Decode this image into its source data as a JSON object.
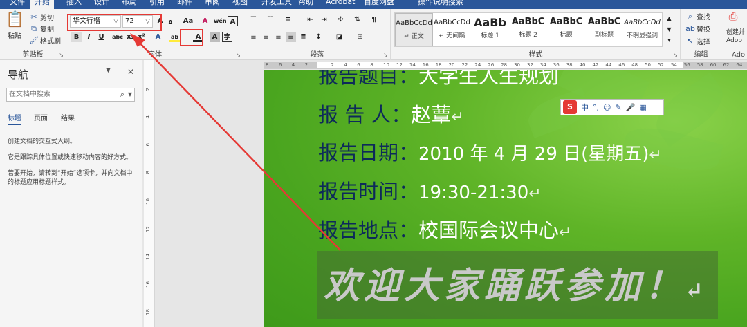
{
  "tabs": [
    "文件",
    "开始",
    "插入",
    "设计",
    "布局",
    "引用",
    "邮件",
    "审阅",
    "视图",
    "开发工具",
    "帮助",
    "Acrobat",
    "百度网盘",
    "操作说明搜索"
  ],
  "clipboard": {
    "paste": "粘贴",
    "cut": "剪切",
    "copy": "复制",
    "format_painter": "格式刷",
    "label": "剪贴板"
  },
  "font": {
    "family": "华文行楷",
    "size": "72",
    "grow": "A",
    "shrink": "A",
    "case": "Aa",
    "clear": "A",
    "label": "字体",
    "bold": "B",
    "italic": "I",
    "underline": "U",
    "strike": "abc",
    "subscript": "x₂",
    "superscript": "x²",
    "effects": "A",
    "highlight": "ab",
    "color": "A",
    "shading": "A",
    "border": "A"
  },
  "paragraph": {
    "label": "段落"
  },
  "styles": {
    "label": "样式",
    "items": [
      {
        "preview": "AaBbCcDd",
        "name": "↵ 正文"
      },
      {
        "preview": "AaBbCcDd",
        "name": "↵ 无间隔"
      },
      {
        "preview": "AaBb",
        "name": "标题 1"
      },
      {
        "preview": "AaBbC",
        "name": "标题 2"
      },
      {
        "preview": "AaBbC",
        "name": "标题"
      },
      {
        "preview": "AaBbC",
        "name": "副标题"
      },
      {
        "preview": "AaBbCcDd",
        "name": "不明显强调"
      }
    ]
  },
  "editing": {
    "find": "查找",
    "replace": "替换",
    "select": "选择",
    "label": "编辑"
  },
  "adobe": {
    "create": "创建并",
    "adobe": "Adob",
    "label": "Ado"
  },
  "nav": {
    "title": "导航",
    "search_placeholder": "在文档中搜索",
    "tabs": [
      "标题",
      "页面",
      "结果"
    ],
    "text1": "创建文档的交互式大纲。",
    "text2": "它是跟踪具体位置或快速移动内容的好方式。",
    "text3": "若要开始，请转到“开始”选项卡，并向文档中的标题应用标题样式。"
  },
  "doc": {
    "line0_label": "报告题目：",
    "line0_value": "大学生人生规划",
    "line1_label": "报 告 人：",
    "line1_value": "赵蕈",
    "line2_label": "报告日期：",
    "line2_value": "2010 年 4 月 29 日(星期五)",
    "line3_label": "报告时间：",
    "line3_value": "19:30-21:30",
    "line4_label": "报告地点：",
    "line4_value": "校国际会议中心",
    "welcome": "欢迎大家踊跃参加！",
    "para_mark": "↵"
  },
  "ime": {
    "logo": "S",
    "lang": "中",
    "punct": "°,",
    "emoji": "☺",
    "pen": "✎",
    "mic": "🎤",
    "grid": "▦"
  },
  "ruler_ticks": [
    "8",
    "6",
    "4",
    "2",
    "",
    "2",
    "4",
    "6",
    "8",
    "10",
    "12",
    "14",
    "16",
    "18",
    "20",
    "22",
    "24",
    "26",
    "28",
    "30",
    "32",
    "34",
    "36",
    "38",
    "40",
    "42",
    "44",
    "46",
    "48",
    "50",
    "52",
    "54",
    "56",
    "58",
    "60",
    "62",
    "64"
  ],
  "annotation_color": "#e53935",
  "accent": "#2b579a"
}
